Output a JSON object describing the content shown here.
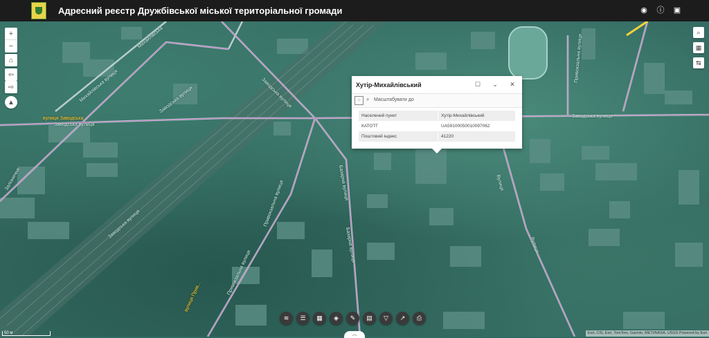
{
  "header": {
    "title": "Адресний реєстр Дружбівської міської територіальної громади"
  },
  "map_controls": {
    "zoom_in": "+",
    "zoom_out": "−"
  },
  "streets": {
    "zavodska_highlight": "вулиця Заводська",
    "zavodska_1": "Заводська вулиця",
    "zavodska_2": "Заводська вулиця",
    "zavodska_3": "Заводська вулиця",
    "zavodska_4": "Заводська вулиця",
    "zavodska_5": "Заводська вулиця",
    "mykhailivska": "Михайлівська вулиця",
    "mykhailivska2": "Михайлівська",
    "pryvokzalna_1": "Привокзальна вулиця",
    "pryvokzalna_2": "Привокзальна вулиця",
    "pryvokzalna_3": "Привокзальна вулиця",
    "bazarna_1": "Базарна вулиця",
    "bazarna_2": "Базарна вулиця",
    "zaliznychna": "Залізнична",
    "vulytsia_1": "Вулиця",
    "vulytsia_2": "Вулиця",
    "highlight_bottom": "вулиця Прив..."
  },
  "popup": {
    "title": "Хутір-Михайлівський",
    "zoom_to_label": "Масштабувати до",
    "rows": [
      {
        "field": "Населений пункт",
        "value": "Хутір-Михайлівський"
      },
      {
        "field": "КАТОТГ",
        "value": "UA59100050010097062"
      },
      {
        "field": "Поштовий індекс",
        "value": "41220"
      }
    ]
  },
  "attribution": "Esri, CIS, Esri, TomTom, Garmin, METI/NASA, USGS   Powered by Esri",
  "scale_label": "50 м"
}
